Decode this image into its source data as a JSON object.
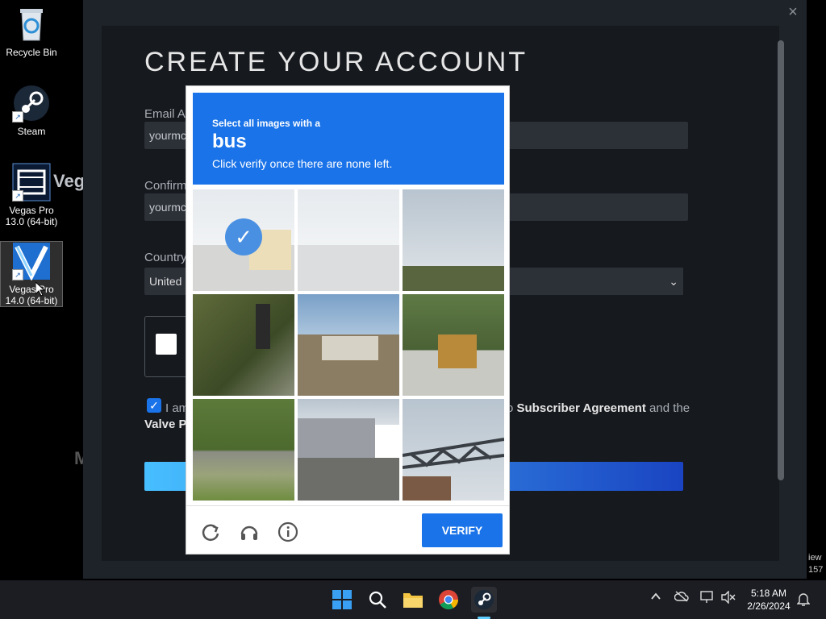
{
  "desktop": {
    "icons": [
      {
        "label": "Recycle Bin"
      },
      {
        "label": "Steam"
      },
      {
        "label": "Vegas Pro 13.0 (64-bit)"
      },
      {
        "label": "Vegas Pro 14.0 (64-bit)"
      }
    ],
    "side_text": "Veg",
    "side_m": "M",
    "edge_text1": "iew",
    "edge_text2": "157"
  },
  "steam": {
    "title": "CREATE YOUR ACCOUNT",
    "email_label": "Email Ac",
    "email_value": "yourmc",
    "confirm_label": "Confirm",
    "confirm_value": "yourmc",
    "country_label": "Country",
    "country_value": "United",
    "select_chevron": "⌄",
    "agree_pre": "I am",
    "agree_right_link": "Subscriber Agreement",
    "agree_right_suffix": " and the",
    "agree_right_prefix": "o ",
    "valve_pr": "Valve Pr",
    "close": "×"
  },
  "captcha": {
    "line1": "Select all images with a",
    "line2": "bus",
    "line3": "Click verify once there are none left.",
    "verify": "VERIFY",
    "selected_tile": 1
  },
  "taskbar": {
    "time": "5:18 AM",
    "date": "2/26/2024"
  },
  "colors": {
    "accent": "#1a73e8",
    "steam_bg": "#1e2329"
  }
}
